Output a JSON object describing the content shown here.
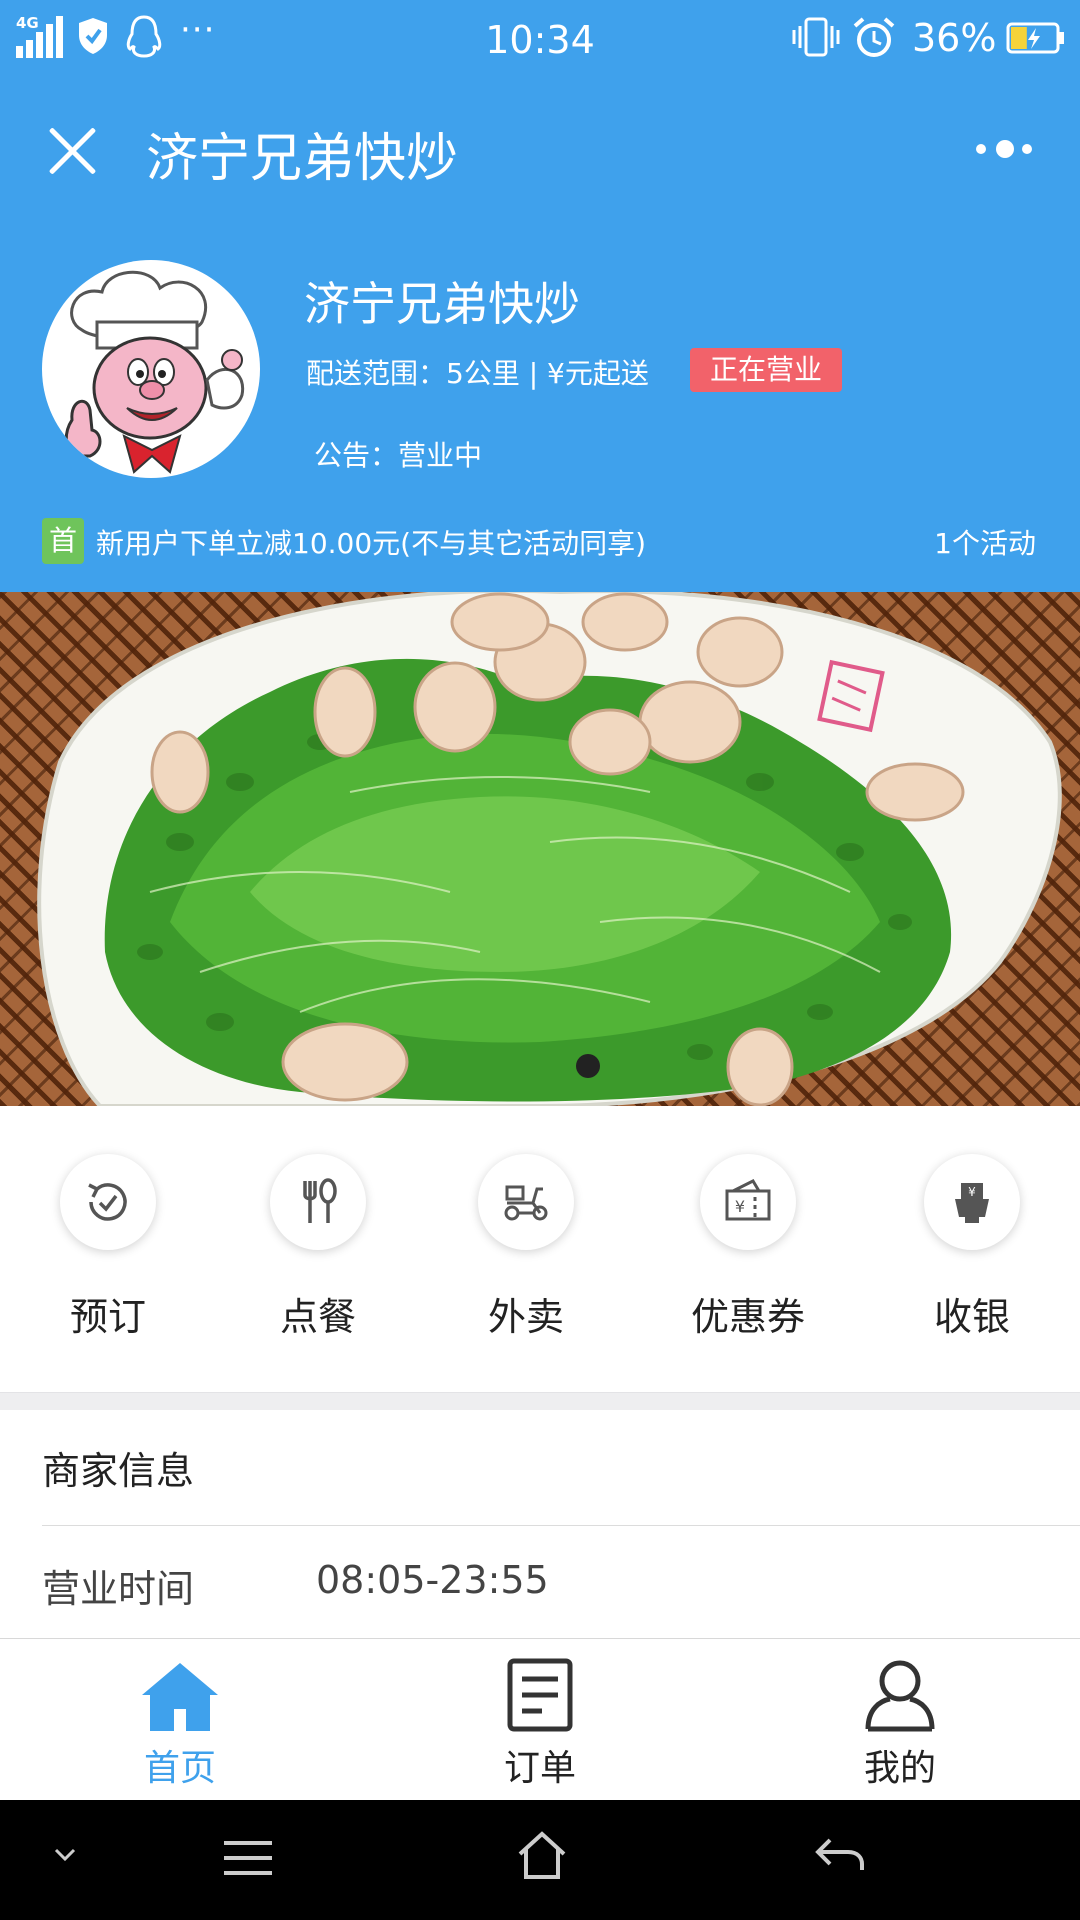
{
  "status_bar": {
    "network": "4G",
    "time": "10:34",
    "battery": "36%",
    "battery_level": 0.36,
    "icons": [
      "signal-icon",
      "shield-icon",
      "qq-penguin-icon",
      "more-dots-icon",
      "vibrate-icon",
      "alarm-icon",
      "battery-icon"
    ]
  },
  "header": {
    "title": "济宁兄弟快炒",
    "close_icon": "close-icon",
    "more_icon": "more-icon"
  },
  "shop": {
    "name": "济宁兄弟快炒",
    "delivery_info": "配送范围：5公里 | ¥元起送",
    "status_badge": "正在营业",
    "notice": "公告：营业中",
    "avatar_icon": "chef-avatar"
  },
  "promo": {
    "tag": "首",
    "text": "新用户下单立减10.00元(不与其它活动同享)",
    "count": "1个活动"
  },
  "banner": {
    "image": "sprout-walnut-salad",
    "slide_count": 1,
    "active_slide": 1
  },
  "features": [
    {
      "label": "预订",
      "icon": "reserve-clock-icon"
    },
    {
      "label": "点餐",
      "icon": "fork-spoon-icon"
    },
    {
      "label": "外卖",
      "icon": "scooter-icon"
    },
    {
      "label": "优惠券",
      "icon": "coupon-icon"
    },
    {
      "label": "收银",
      "icon": "cashier-icon"
    }
  ],
  "merchant_info": {
    "heading": "商家信息",
    "hours_label": "营业时间",
    "hours_value": "08:05-23:55"
  },
  "tabbar": {
    "tabs": [
      {
        "label": "首页",
        "icon": "home-icon",
        "active": true
      },
      {
        "label": "订单",
        "icon": "order-list-icon",
        "active": false
      },
      {
        "label": "我的",
        "icon": "user-icon",
        "active": false
      }
    ]
  },
  "colors": {
    "primary": "#3fa1ec",
    "badge_red": "#f2626a",
    "promo_green": "#6fc45b"
  },
  "system_nav": {
    "icons": [
      "collapse-chevron-icon",
      "menu-icon",
      "home-outline-icon",
      "back-icon"
    ]
  }
}
